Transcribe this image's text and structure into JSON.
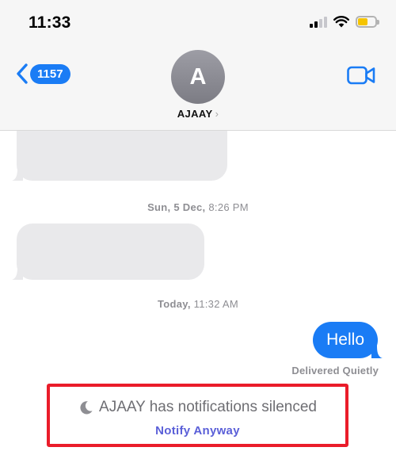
{
  "status_bar": {
    "time": "11:33",
    "signal_bars_active": 2,
    "battery_color": "#f5c400"
  },
  "header": {
    "back_badge": "1157",
    "avatar_initial": "A",
    "contact_name": "AJAAY",
    "contact_chevron": "›",
    "accent_color": "#1a7cf5",
    "icons": [
      "chevron-left-icon",
      "video-camera-icon"
    ]
  },
  "messages": {
    "timestamp_1": {
      "day": "Sun, 5 Dec,",
      "time": "8:26 PM"
    },
    "timestamp_2": {
      "day": "Today,",
      "time": "11:32 AM"
    },
    "outgoing_text": "Hello",
    "delivery_status": "Delivered Quietly",
    "incoming_bubble_color": "#e9e9eb",
    "outgoing_bubble_color": "#1a7cf5"
  },
  "silenced_notice": {
    "icon": "moon-icon",
    "text": "AJAAY has notifications silenced",
    "action": "Notify Anyway",
    "highlight_color": "#ea1c2a"
  }
}
